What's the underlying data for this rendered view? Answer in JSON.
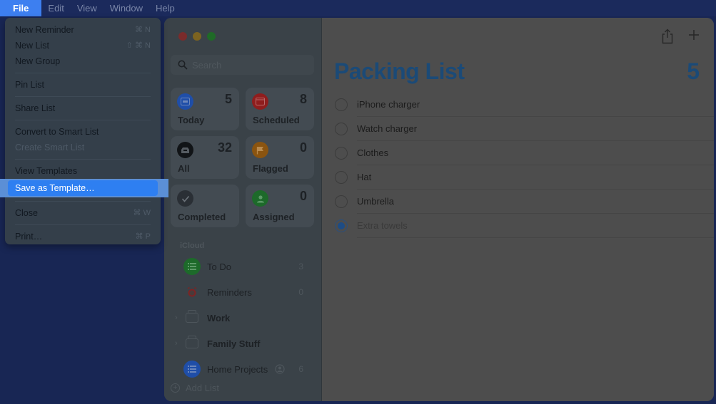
{
  "menubar": {
    "items": [
      {
        "label": "File",
        "active": true
      },
      {
        "label": "Edit"
      },
      {
        "label": "View"
      },
      {
        "label": "Window"
      },
      {
        "label": "Help"
      }
    ]
  },
  "file_menu": {
    "items": [
      {
        "label": "New Reminder",
        "shortcut": "⌘ N"
      },
      {
        "label": "New List",
        "shortcut": "⇧ ⌘ N"
      },
      {
        "label": "New Group",
        "shortcut": ""
      },
      {
        "label": "Pin List",
        "shortcut": ""
      },
      {
        "label": "Share List",
        "shortcut": ""
      },
      {
        "label": "Convert to Smart List",
        "shortcut": ""
      },
      {
        "label": "Create Smart List",
        "shortcut": "",
        "disabled": true
      },
      {
        "label": "View Templates",
        "shortcut": ""
      },
      {
        "label": "Save as Template…",
        "shortcut": "",
        "highlighted": true
      },
      {
        "label": "Close",
        "shortcut": "⌘ W"
      },
      {
        "label": "Print…",
        "shortcut": "⌘ P"
      }
    ]
  },
  "sidebar": {
    "search_placeholder": "Search",
    "smart_lists": [
      {
        "label": "Today",
        "count": "5",
        "icon": "calendar-today-icon",
        "color": "#1f4ea8"
      },
      {
        "label": "Scheduled",
        "count": "8",
        "icon": "calendar-icon",
        "color": "#8f1d1d"
      },
      {
        "label": "All",
        "count": "32",
        "icon": "tray-icon",
        "color": "#111417"
      },
      {
        "label": "Flagged",
        "count": "0",
        "icon": "flag-icon",
        "color": "#8a5410"
      },
      {
        "label": "Completed",
        "count": "",
        "icon": "checkmark-icon",
        "color": "#2a2f35"
      },
      {
        "label": "Assigned",
        "count": "0",
        "icon": "person-icon",
        "color": "#1d6a2a"
      }
    ],
    "section_label": "iCloud",
    "lists": [
      {
        "label": "To Do",
        "count": "3",
        "type": "list",
        "color": "#1d6a2a"
      },
      {
        "label": "Reminders",
        "count": "0",
        "type": "alarm",
        "color": "#7c2424"
      },
      {
        "label": "Work",
        "count": "",
        "type": "group"
      },
      {
        "label": "Family Stuff",
        "count": "",
        "type": "group"
      },
      {
        "label": "Home Projects",
        "count": "6",
        "type": "list",
        "color": "#1f4ea8",
        "shared": true
      }
    ],
    "add_list_label": "Add List"
  },
  "main": {
    "title": "Packing List",
    "count": "5",
    "accent_color": "#1b4a77",
    "tasks": [
      {
        "label": "iPhone charger",
        "completed": false
      },
      {
        "label": "Watch charger",
        "completed": false
      },
      {
        "label": "Clothes",
        "completed": false
      },
      {
        "label": "Hat",
        "completed": false
      },
      {
        "label": "Umbrella",
        "completed": false
      },
      {
        "label": "Extra towels",
        "completed": true
      }
    ]
  }
}
